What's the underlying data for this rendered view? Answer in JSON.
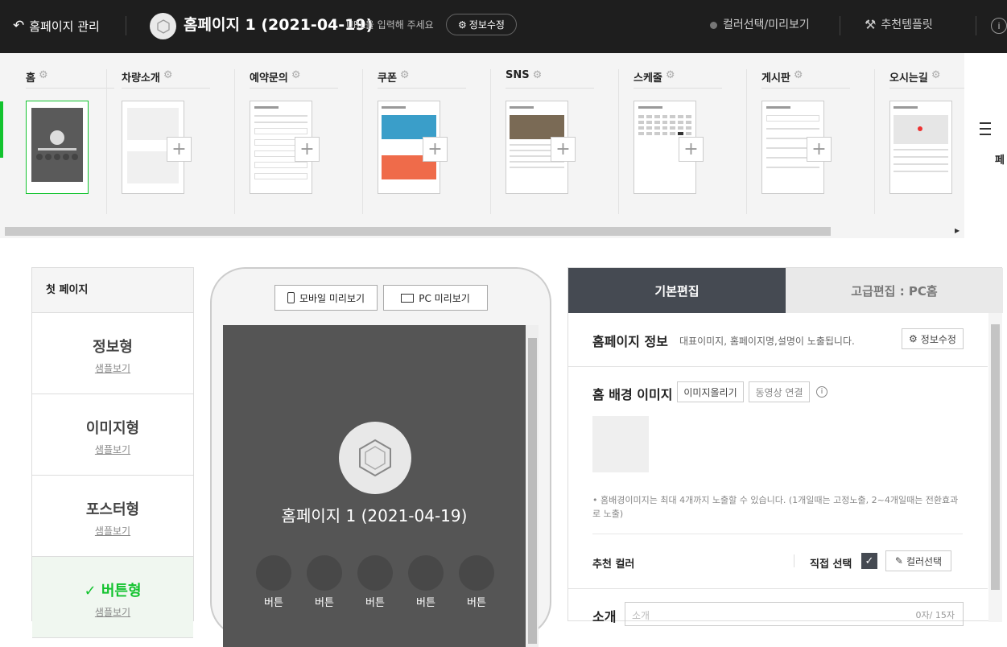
{
  "topbar": {
    "back_label": "홈페이지 관리",
    "site_title": "홈페이지 1 (2021-04-19)",
    "url_placeholder": "URL을 입력해 주세요",
    "info_edit_label": "정보수정",
    "color_preview_label": "컬러선택/미리보기",
    "template_label": "추천템플릿",
    "help_symbol": "i"
  },
  "pages": [
    {
      "label": "홈"
    },
    {
      "label": "차량소개"
    },
    {
      "label": "예약문의"
    },
    {
      "label": "쿠폰"
    },
    {
      "label": "SNS"
    },
    {
      "label": "스케줄"
    },
    {
      "label": "게시판"
    },
    {
      "label": "오시는길"
    }
  ],
  "strip": {
    "right_pane_text": "페"
  },
  "first_page": {
    "header": "첫 페이지",
    "preview_link": "샘플보기",
    "types": [
      {
        "name": "정보형",
        "selected": false
      },
      {
        "name": "이미지형",
        "selected": false
      },
      {
        "name": "포스터형",
        "selected": false
      },
      {
        "name": "버튼형",
        "selected": true
      }
    ],
    "check_mark": "✓"
  },
  "preview": {
    "mobile_label": "모바일 미리보기",
    "pc_label": "PC 미리보기",
    "site_title": "홈페이지 1 (2021-04-19)",
    "buttons": [
      "버튼",
      "버튼",
      "버튼",
      "버튼",
      "버튼"
    ]
  },
  "editor": {
    "tab_basic": "기본편집",
    "tab_advanced": "고급편집 : PC홈",
    "info": {
      "title": "홈페이지 정보",
      "desc": "대표이미지, 홈페이지명,설명이 노출됩니다.",
      "edit_label": "정보수정"
    },
    "bg": {
      "title": "홈 배경 이미지",
      "upload_label": "이미지올리기",
      "video_label": "동영상 연결",
      "note": "홈배경이미지는 최대 4개까지 노출할 수 있습니다. (1개일때는 고정노출, 2~4개일때는 전환효과로 노출)"
    },
    "color": {
      "label": "추천 컬러",
      "direct_label": "직접 선택",
      "picker_label": "컬러선택"
    },
    "intro": {
      "label": "소개",
      "placeholder": "소개",
      "counter": "0자/ 15자"
    }
  },
  "colors": {
    "accent": "#12c32e",
    "topbar": "#1e1e1e",
    "tab_active": "#454a52"
  }
}
